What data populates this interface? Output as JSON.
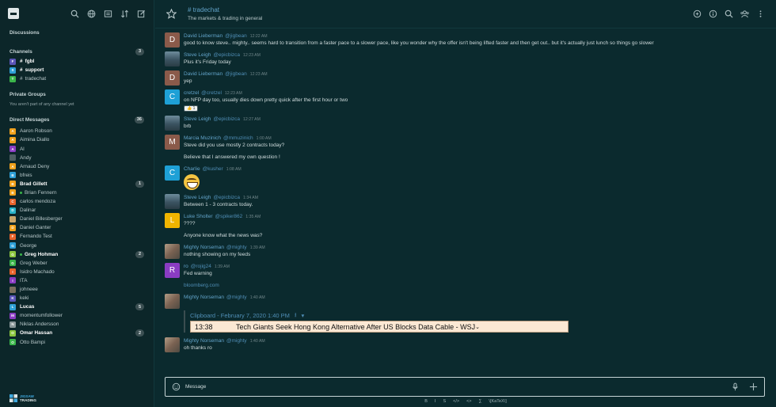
{
  "sidebar": {
    "discussions_label": "Discussions",
    "channels_label": "Channels",
    "channels_count": "3",
    "channels": [
      {
        "letter": "F",
        "name": "fgbl",
        "color": "#5b55b8",
        "bold": true
      },
      {
        "letter": "S",
        "name": "support",
        "color": "#2e9fd6",
        "bold": true
      },
      {
        "letter": "T",
        "name": "tradechat",
        "color": "#3ab54a",
        "bold": false
      }
    ],
    "private_label": "Private Groups",
    "private_empty": "You aren't part of any channel yet",
    "dm_label": "Direct Messages",
    "dm_count": "36",
    "dms": [
      {
        "letter": "A",
        "name": "Aaron Robson",
        "color": "#f0a11c",
        "bold": false,
        "badge": ""
      },
      {
        "letter": "A",
        "name": "Aimina Diallo",
        "color": "#f0a11c",
        "bold": false,
        "badge": ""
      },
      {
        "letter": "A",
        "name": "Al",
        "color": "#8a3cc2",
        "bold": false,
        "badge": ""
      },
      {
        "letter": "",
        "name": "Andy",
        "color": "#4d5f62",
        "bold": false,
        "badge": ""
      },
      {
        "letter": "A",
        "name": "Arnaud Deny",
        "color": "#f0a11c",
        "bold": false,
        "badge": ""
      },
      {
        "letter": "B",
        "name": "bfreis",
        "color": "#2e9fd6",
        "bold": false,
        "badge": ""
      },
      {
        "letter": "B",
        "name": "Brad Gillett",
        "color": "#f0a11c",
        "bold": true,
        "badge": "1"
      },
      {
        "letter": "B",
        "name": "Brian Fennern",
        "color": "#f0a11c",
        "bold": false,
        "badge": "",
        "online": true
      },
      {
        "letter": "C",
        "name": "carlos mendoza",
        "color": "#e8632b",
        "bold": false,
        "badge": ""
      },
      {
        "letter": "D",
        "name": "Dalinar",
        "color": "#2ab3c9",
        "bold": false,
        "badge": ""
      },
      {
        "letter": "",
        "name": "Daniel Billesberger",
        "color": "#c9a66b",
        "bold": false,
        "badge": ""
      },
      {
        "letter": "D",
        "name": "Daniel Ganter",
        "color": "#f0a11c",
        "bold": false,
        "badge": ""
      },
      {
        "letter": "F",
        "name": "Fernando Test",
        "color": "#e8632b",
        "bold": false,
        "badge": ""
      },
      {
        "letter": "G",
        "name": "George",
        "color": "#2e9fd6",
        "bold": false,
        "badge": ""
      },
      {
        "letter": "G",
        "name": "Greg Hohman",
        "color": "#8cc63f",
        "bold": true,
        "badge": "2",
        "online": true
      },
      {
        "letter": "G",
        "name": "Greg Weber",
        "color": "#3ab54a",
        "bold": false,
        "badge": ""
      },
      {
        "letter": "I",
        "name": "Isidro Machado",
        "color": "#e8632b",
        "bold": false,
        "badge": ""
      },
      {
        "letter": "I",
        "name": "ITA",
        "color": "#8a3cc2",
        "bold": false,
        "badge": ""
      },
      {
        "letter": "",
        "name": "johneee",
        "color": "#7a6f5e",
        "bold": false,
        "badge": ""
      },
      {
        "letter": "K",
        "name": "keki",
        "color": "#5b55b8",
        "bold": false,
        "badge": ""
      },
      {
        "letter": "L",
        "name": "Lucas",
        "color": "#2e9fd6",
        "bold": true,
        "badge": "5"
      },
      {
        "letter": "M",
        "name": "momentumfollower",
        "color": "#8a3cc2",
        "bold": false,
        "badge": ""
      },
      {
        "letter": "N",
        "name": "Niklas Andersson",
        "color": "#8a9799",
        "bold": false,
        "badge": ""
      },
      {
        "letter": "O",
        "name": "Omar Hassan",
        "color": "#8cc63f",
        "bold": true,
        "badge": "2"
      },
      {
        "letter": "O",
        "name": "Otto Bampi",
        "color": "#3ab54a",
        "bold": false,
        "badge": ""
      }
    ],
    "logo_line1": "JIGSAW",
    "logo_line2": "TRADING"
  },
  "header": {
    "channel": "# tradechat",
    "topic": "The markets & trading in general"
  },
  "messages": [
    {
      "kind": "msg",
      "avatar": "D",
      "avcolor": "#8a5a4a",
      "name": "David Lieberman",
      "user": "@jigbean",
      "time": "12:22 AM",
      "text": "good to know steve.. mighty.. seems hard to transition from a faster pace to a slower pace, like you wonder why the offer isn't being lifted faster and then get out.. but it's actually just lunch so things go slower"
    },
    {
      "kind": "msg",
      "avatar": "",
      "avimg": "img",
      "name": "Steve Leigh",
      "user": "@epicbizca",
      "time": "12:23 AM",
      "text": "Plus it's Friday today"
    },
    {
      "kind": "msg",
      "avatar": "D",
      "avcolor": "#8a5a4a",
      "name": "David Lieberman",
      "user": "@jigbean",
      "time": "12:23 AM",
      "text": "yep"
    },
    {
      "kind": "msg",
      "avatar": "C",
      "avcolor": "#1ea0d6",
      "name": "cretzel",
      "user": "@cretzel",
      "time": "12:23 AM",
      "text": "on NFP day too, usually dies down pretty quick after the first hour or two",
      "reaction": "👍 1"
    },
    {
      "kind": "msg",
      "avatar": "",
      "avimg": "img",
      "name": "Steve Leigh",
      "user": "@epicbizca",
      "time": "12:27 AM",
      "text": "brb"
    },
    {
      "kind": "msg",
      "avatar": "M",
      "avcolor": "#8a5a4a",
      "name": "Marcia Muzinich",
      "user": "@mmuzinich",
      "time": "1:00 AM",
      "text": "Steve did you use mostly 2 contracts today?"
    },
    {
      "kind": "cont",
      "text": "Believe that I answered my own question !"
    },
    {
      "kind": "msg",
      "avatar": "C",
      "avcolor": "#1ea0d6",
      "name": "Charlie",
      "user": "@kusher",
      "time": "1:08 AM",
      "text": "",
      "emoji": true
    },
    {
      "kind": "msg",
      "avatar": "",
      "avimg": "img",
      "name": "Steve Leigh",
      "user": "@epicbizca",
      "time": "1:34 AM",
      "text": "Between 1 - 3 contracts today."
    },
    {
      "kind": "msg",
      "avatar": "L",
      "avcolor": "#f0b400",
      "name": "Luke Sholter",
      "user": "@spiker862",
      "time": "1:35 AM",
      "text": "????"
    },
    {
      "kind": "cont",
      "text": "Anyone know what the news was?"
    },
    {
      "kind": "msg",
      "avatar": "",
      "avimg": "img2",
      "name": "Mighty Norseman",
      "user": "@mighty",
      "time": "1:39 AM",
      "text": "nothing showing on my feeds"
    },
    {
      "kind": "msg",
      "avatar": "R",
      "avcolor": "#8a3cc2",
      "name": "ro",
      "user": "@rojig24",
      "time": "1:39 AM",
      "text": "Fed warning"
    },
    {
      "kind": "cont",
      "text": "bloomberg.com",
      "link": true
    },
    {
      "kind": "msg",
      "avatar": "",
      "avimg": "img2",
      "name": "Mighty Norseman",
      "user": "@mighty",
      "time": "1:40 AM",
      "text": "",
      "embed": true
    },
    {
      "kind": "msg",
      "avatar": "",
      "avimg": "img2",
      "name": "Mighty Norseman",
      "user": "@mighty",
      "time": "1:40 AM",
      "text": "oh thanks ro"
    }
  ],
  "embed": {
    "title": "Clipboard - February 7, 2020 1:40 PM",
    "news_time": "13:38",
    "news_headline": "Tech Giants Seek Hong Kong Alternative After US Blocks Data Cable - WSJ"
  },
  "composer": {
    "placeholder": "Message"
  },
  "format_bar": [
    "B",
    "I",
    "S",
    "</>",
    "<>",
    "∑",
    "\\[KaTeX\\]"
  ]
}
